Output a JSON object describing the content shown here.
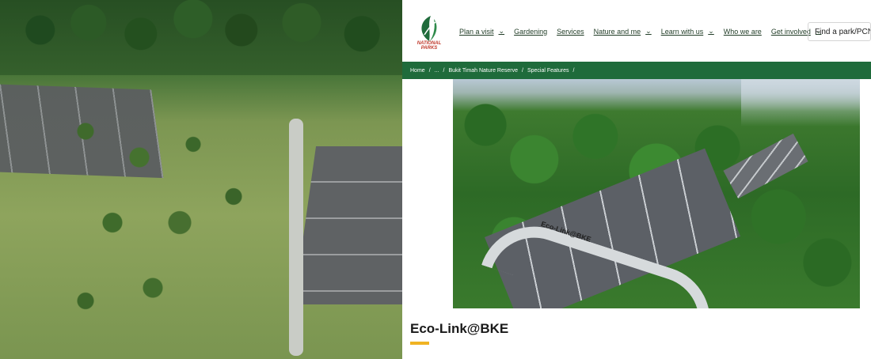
{
  "site": {
    "logo_text": "NATIONAL PARKS",
    "nav": [
      {
        "label": "Plan a visit",
        "has_dropdown": true
      },
      {
        "label": "Gardening",
        "has_dropdown": false
      },
      {
        "label": "Services",
        "has_dropdown": false
      },
      {
        "label": "Nature and me",
        "has_dropdown": true
      },
      {
        "label": "Learn with us",
        "has_dropdown": true
      },
      {
        "label": "Who we are",
        "has_dropdown": false
      },
      {
        "label": "Get involved",
        "has_dropdown": true
      }
    ],
    "find_button": "Find a park/PCN",
    "breadcrumb": [
      "Home",
      "...",
      "Bukit Timah Nature Reserve",
      "Special Features"
    ],
    "hero_sign": "Eco-Link@BKE",
    "page_title": "Eco-Link@BKE",
    "colors": {
      "brand_green": "#1f6b3b",
      "accent_yellow": "#f0b323",
      "logo_red": "#c0392b"
    }
  }
}
